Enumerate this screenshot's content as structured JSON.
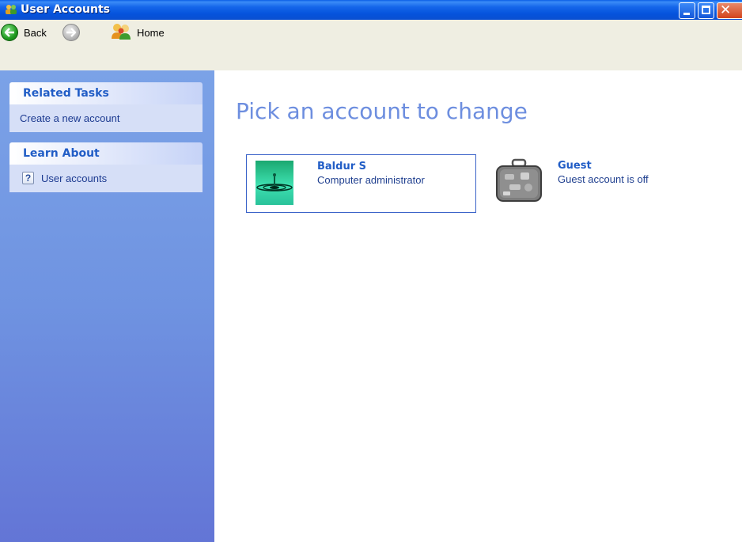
{
  "window": {
    "title": "User Accounts",
    "accent": "#0553dc"
  },
  "toolbar": {
    "back_label": "Back",
    "home_label": "Home"
  },
  "sidebar": {
    "related_tasks": {
      "heading": "Related Tasks",
      "items": [
        {
          "label": "Create a new account"
        }
      ]
    },
    "learn_about": {
      "heading": "Learn About",
      "items": [
        {
          "label": "User accounts",
          "icon": "help-icon"
        }
      ]
    }
  },
  "main": {
    "heading": "Pick an account to change",
    "accounts": [
      {
        "name": "Baldur S",
        "type": "Computer administrator",
        "icon": "water-drop-avatar"
      },
      {
        "name": "Guest",
        "type": "Guest account is off",
        "icon": "suitcase-avatar"
      }
    ]
  }
}
